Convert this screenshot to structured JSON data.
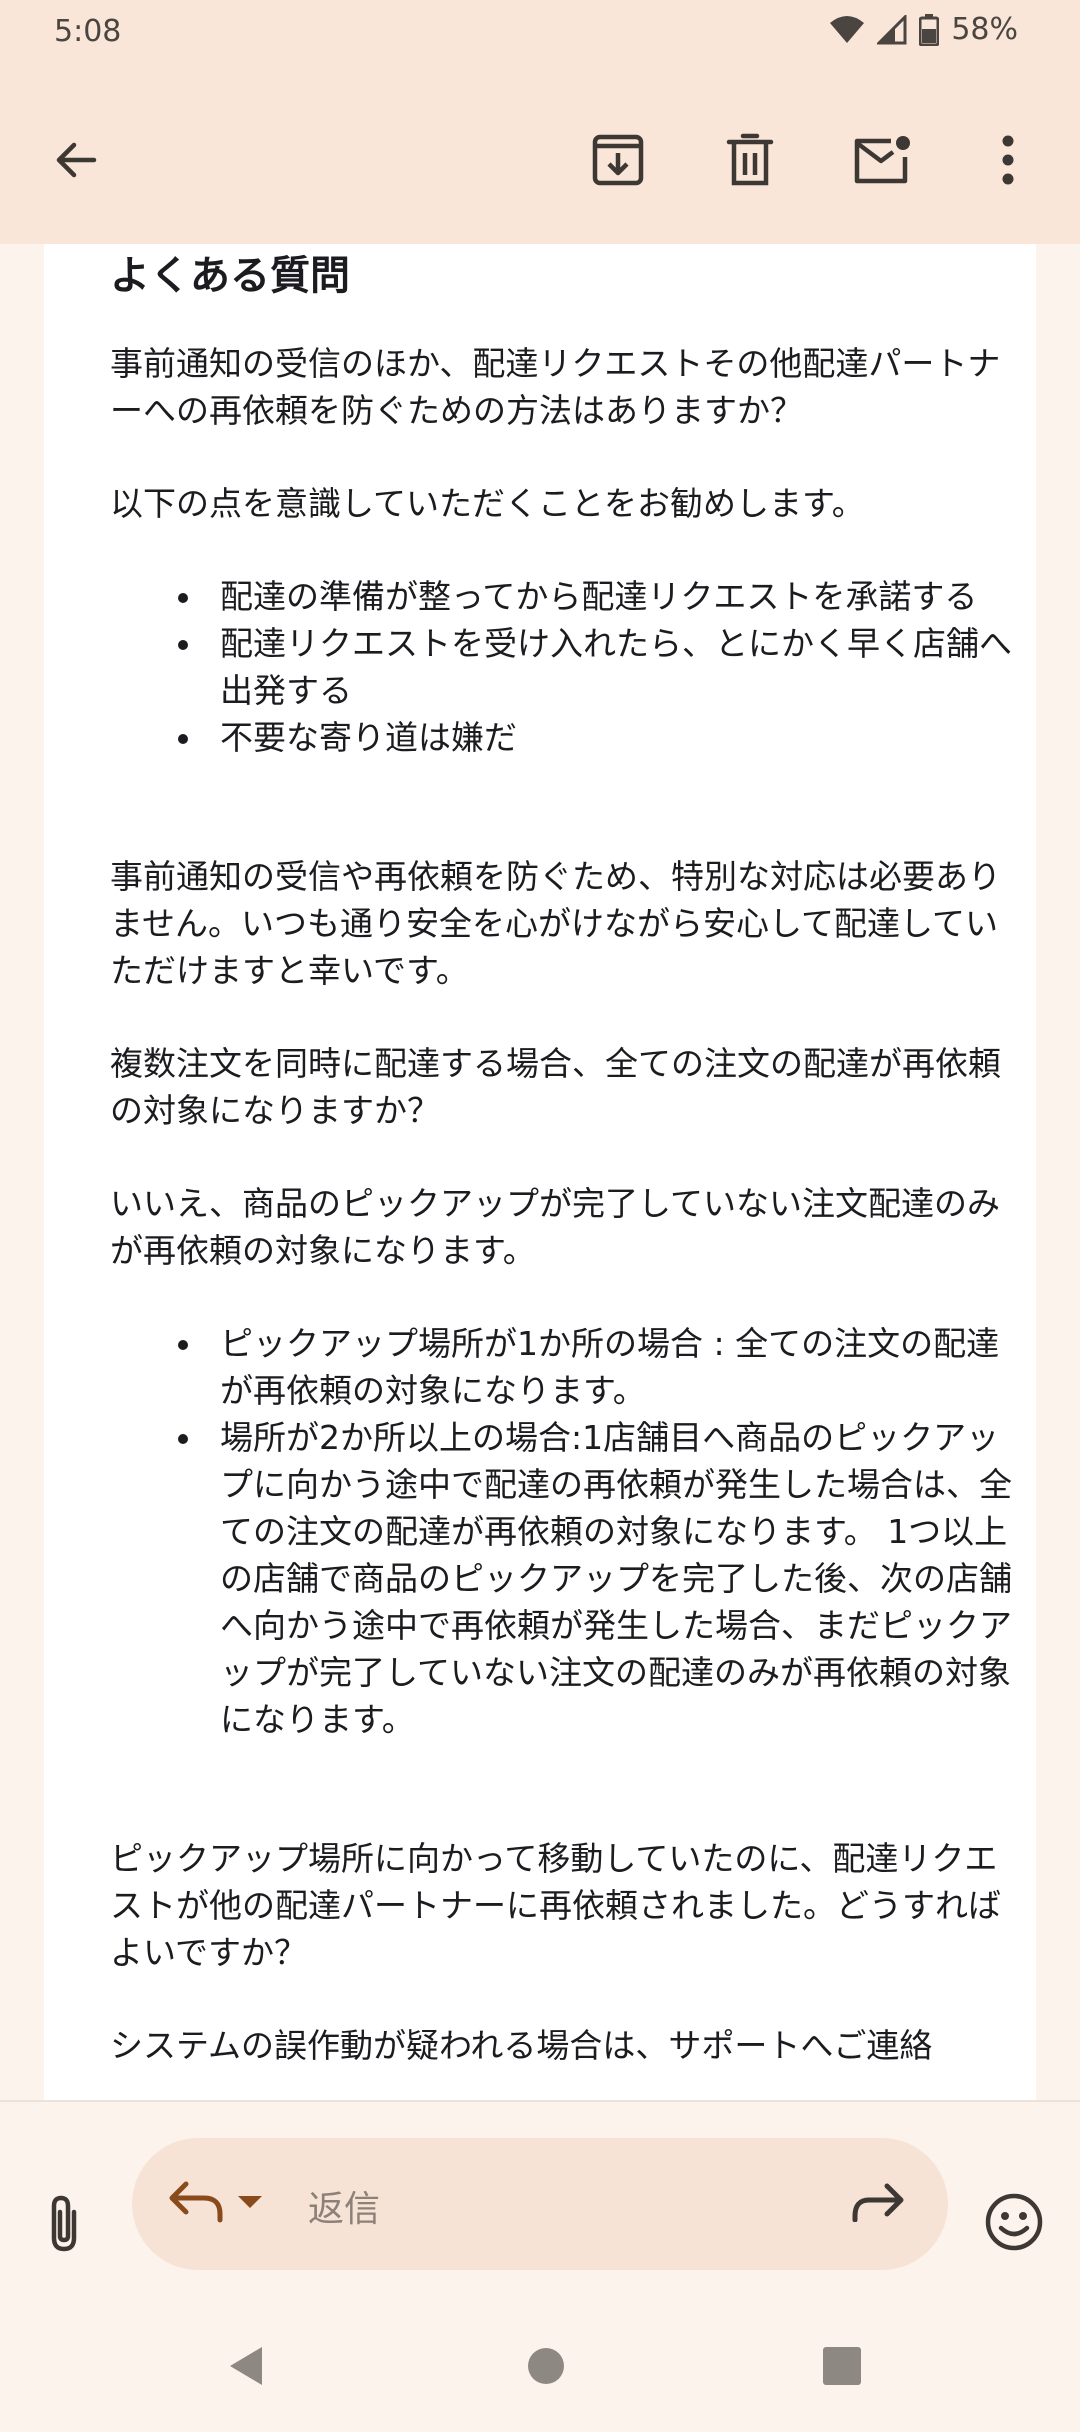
{
  "status": {
    "time": "5:08",
    "battery": "58%"
  },
  "toolbar": {
    "icons": [
      "back-arrow-icon",
      "archive-icon",
      "trash-icon",
      "mark-unread-icon",
      "more-vert-icon"
    ]
  },
  "email": {
    "heading": "よくある質問",
    "q1": "事前通知の受信のほか、配達リクエストその他配達パートナーへの再依頼を防ぐための方法はありますか？",
    "a1_intro": "以下の点を意識していただくことをお勧めします。",
    "a1_bullets": [
      "配達の準備が整ってから配達リクエストを承諾する",
      "配達リクエストを受け入れたら、とにかく早く店舗へ出発する",
      "不要な寄り道は嫌だ"
    ],
    "a1_outro": "事前通知の受信や再依頼を防ぐため、特別な対応は必要ありません。いつも通り安全を心がけながら安心して配達していただけますと幸いです。",
    "q2": "複数注文を同時に配達する場合、全ての注文の配達が再依頼の対象になりますか？",
    "a2_intro": "いいえ、商品のピックアップが完了していない注文配達のみが再依頼の対象になります。",
    "a2_bullets": [
      "ピックアップ場所が1か所の場合 : 全ての注文の配達が再依頼の対象になります。",
      "場所が2か所以上の場合:1店舗目へ商品のピックアップに向かう途中で配達の再依頼が発生した場合は、全ての注文の配達が再依頼の対象になります。 1つ以上の店舗で商品のピックアップを完了した後、次の店舗へ向かう途中で再依頼が発生した場合、まだピックアップが完了していない注文の配達のみが再依頼の対象になります。"
    ],
    "q3": "ピックアップ場所に向かって移動していたのに、配達リクエストが他の配達パートナーに再依頼されました。どうすればよいですか？",
    "a3": "システムの誤作動が疑われる場合は、サポートへご連絡"
  },
  "reply": {
    "placeholder": "返信"
  },
  "colors": {
    "toolbar_bg": "#fae6d8",
    "page_bg": "#fcf3ec",
    "reply_accent": "#8a4b1c"
  }
}
